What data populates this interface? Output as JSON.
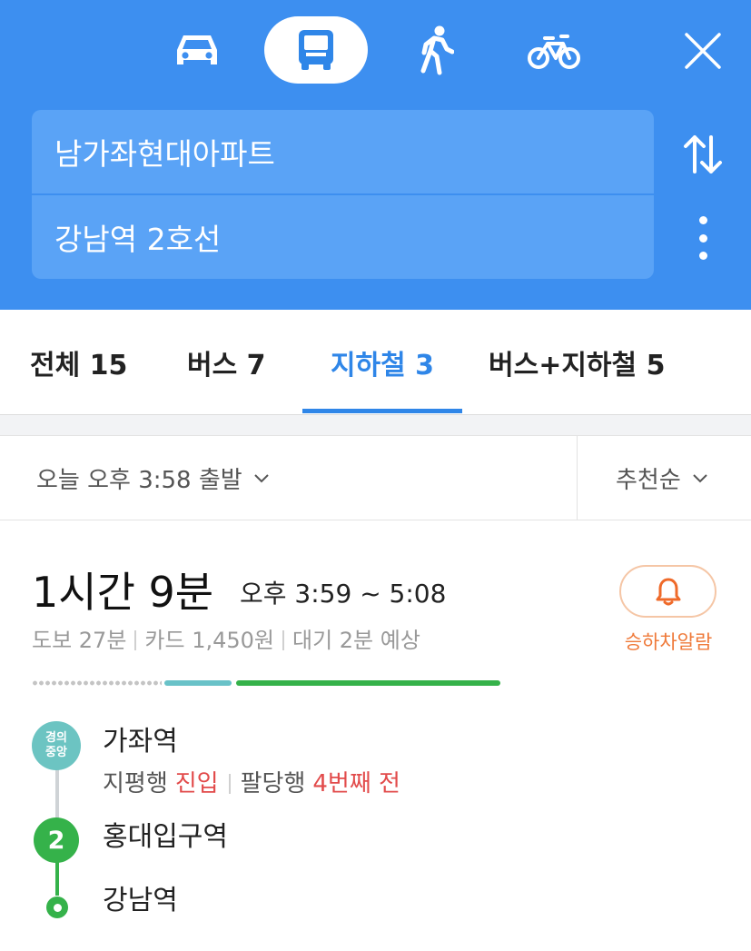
{
  "header": {
    "origin": "남가좌현대아파트",
    "destination": "강남역 2호선"
  },
  "modes": [
    {
      "name": "car",
      "icon": "car-icon"
    },
    {
      "name": "transit",
      "icon": "bus-icon",
      "selected": true
    },
    {
      "name": "walk",
      "icon": "walk-icon"
    },
    {
      "name": "bike",
      "icon": "bike-icon"
    }
  ],
  "tabs": [
    {
      "label": "전체 15"
    },
    {
      "label": "버스 7"
    },
    {
      "label": "지하철 3",
      "selected": true
    },
    {
      "label": "버스+지하철 5"
    }
  ],
  "filter": {
    "departure": "오늘 오후 3:58 출발",
    "sort": "추천순"
  },
  "route": {
    "duration": "1시간 9분",
    "time_range": "오후 3:59 ~ 5:08",
    "walk": "도보 27분",
    "fare": "카드 1,450원",
    "wait": "대기 2분 예상",
    "alarm_label": "승하차알람",
    "stations": [
      {
        "line_badge": "경의\n중앙",
        "name": "가좌역",
        "arrivals": [
          {
            "dest": "지평행",
            "status": "진입"
          },
          {
            "dest": "팔당행",
            "status": "4번째 전"
          }
        ]
      },
      {
        "line_badge": "2",
        "name": "홍대입구역"
      },
      {
        "name": "강남역"
      }
    ]
  },
  "colors": {
    "header_bg": "#3d8ff0",
    "accent_blue": "#2f86e8",
    "line_gyeongui": "#6cc4c2",
    "line_2": "#35b24a",
    "alert_red": "#e24b4b",
    "alarm_orange": "#ef7a3a"
  }
}
